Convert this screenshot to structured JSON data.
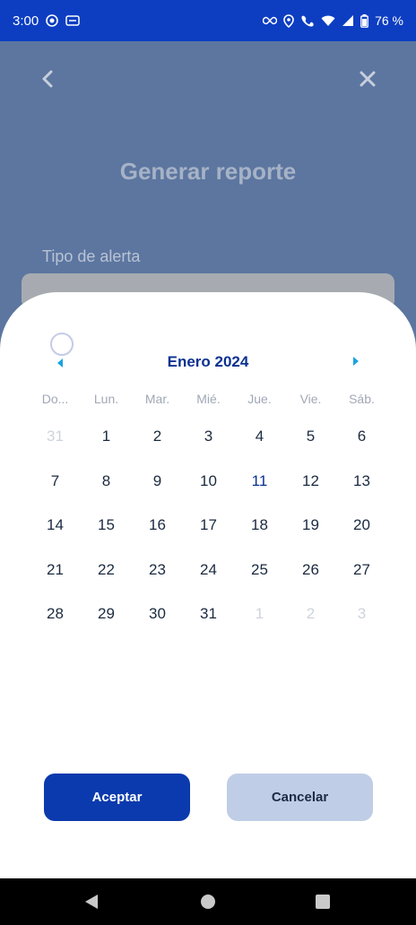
{
  "status_bar": {
    "time": "3:00",
    "battery": "76 %",
    "icons": [
      "record-icon",
      "voicemail-icon",
      "infinity-icon",
      "location-icon",
      "wifi-call-icon",
      "wifi-icon",
      "signal-icon",
      "battery-icon"
    ]
  },
  "background_screen": {
    "title": "Generar reporte",
    "field_label": "Tipo de alerta",
    "back_icon": "chevron-left-icon",
    "close_icon": "close-icon"
  },
  "date_picker": {
    "month_label": "Enero 2024",
    "weekdays": [
      "Do...",
      "Lun.",
      "Mar.",
      "Mié.",
      "Jue.",
      "Vie.",
      "Sáb."
    ],
    "weeks": [
      [
        "31",
        "1",
        "2",
        "3",
        "4",
        "5",
        "6"
      ],
      [
        "7",
        "8",
        "9",
        "10",
        "11",
        "12",
        "13"
      ],
      [
        "14",
        "15",
        "16",
        "17",
        "18",
        "19",
        "20"
      ],
      [
        "21",
        "22",
        "23",
        "24",
        "25",
        "26",
        "27"
      ],
      [
        "28",
        "29",
        "30",
        "31",
        "1",
        "2",
        "3"
      ]
    ],
    "muted": [
      [
        0,
        0
      ],
      [
        4,
        4
      ],
      [
        4,
        5
      ],
      [
        4,
        6
      ]
    ],
    "highlighted": [
      [
        1,
        4
      ]
    ],
    "accept_label": "Aceptar",
    "cancel_label": "Cancelar"
  },
  "colors": {
    "status_bar": "#0d3ec2",
    "accent": "#0a3aad",
    "arrow": "#1aa3e0",
    "overlay": "#5c76a0"
  }
}
